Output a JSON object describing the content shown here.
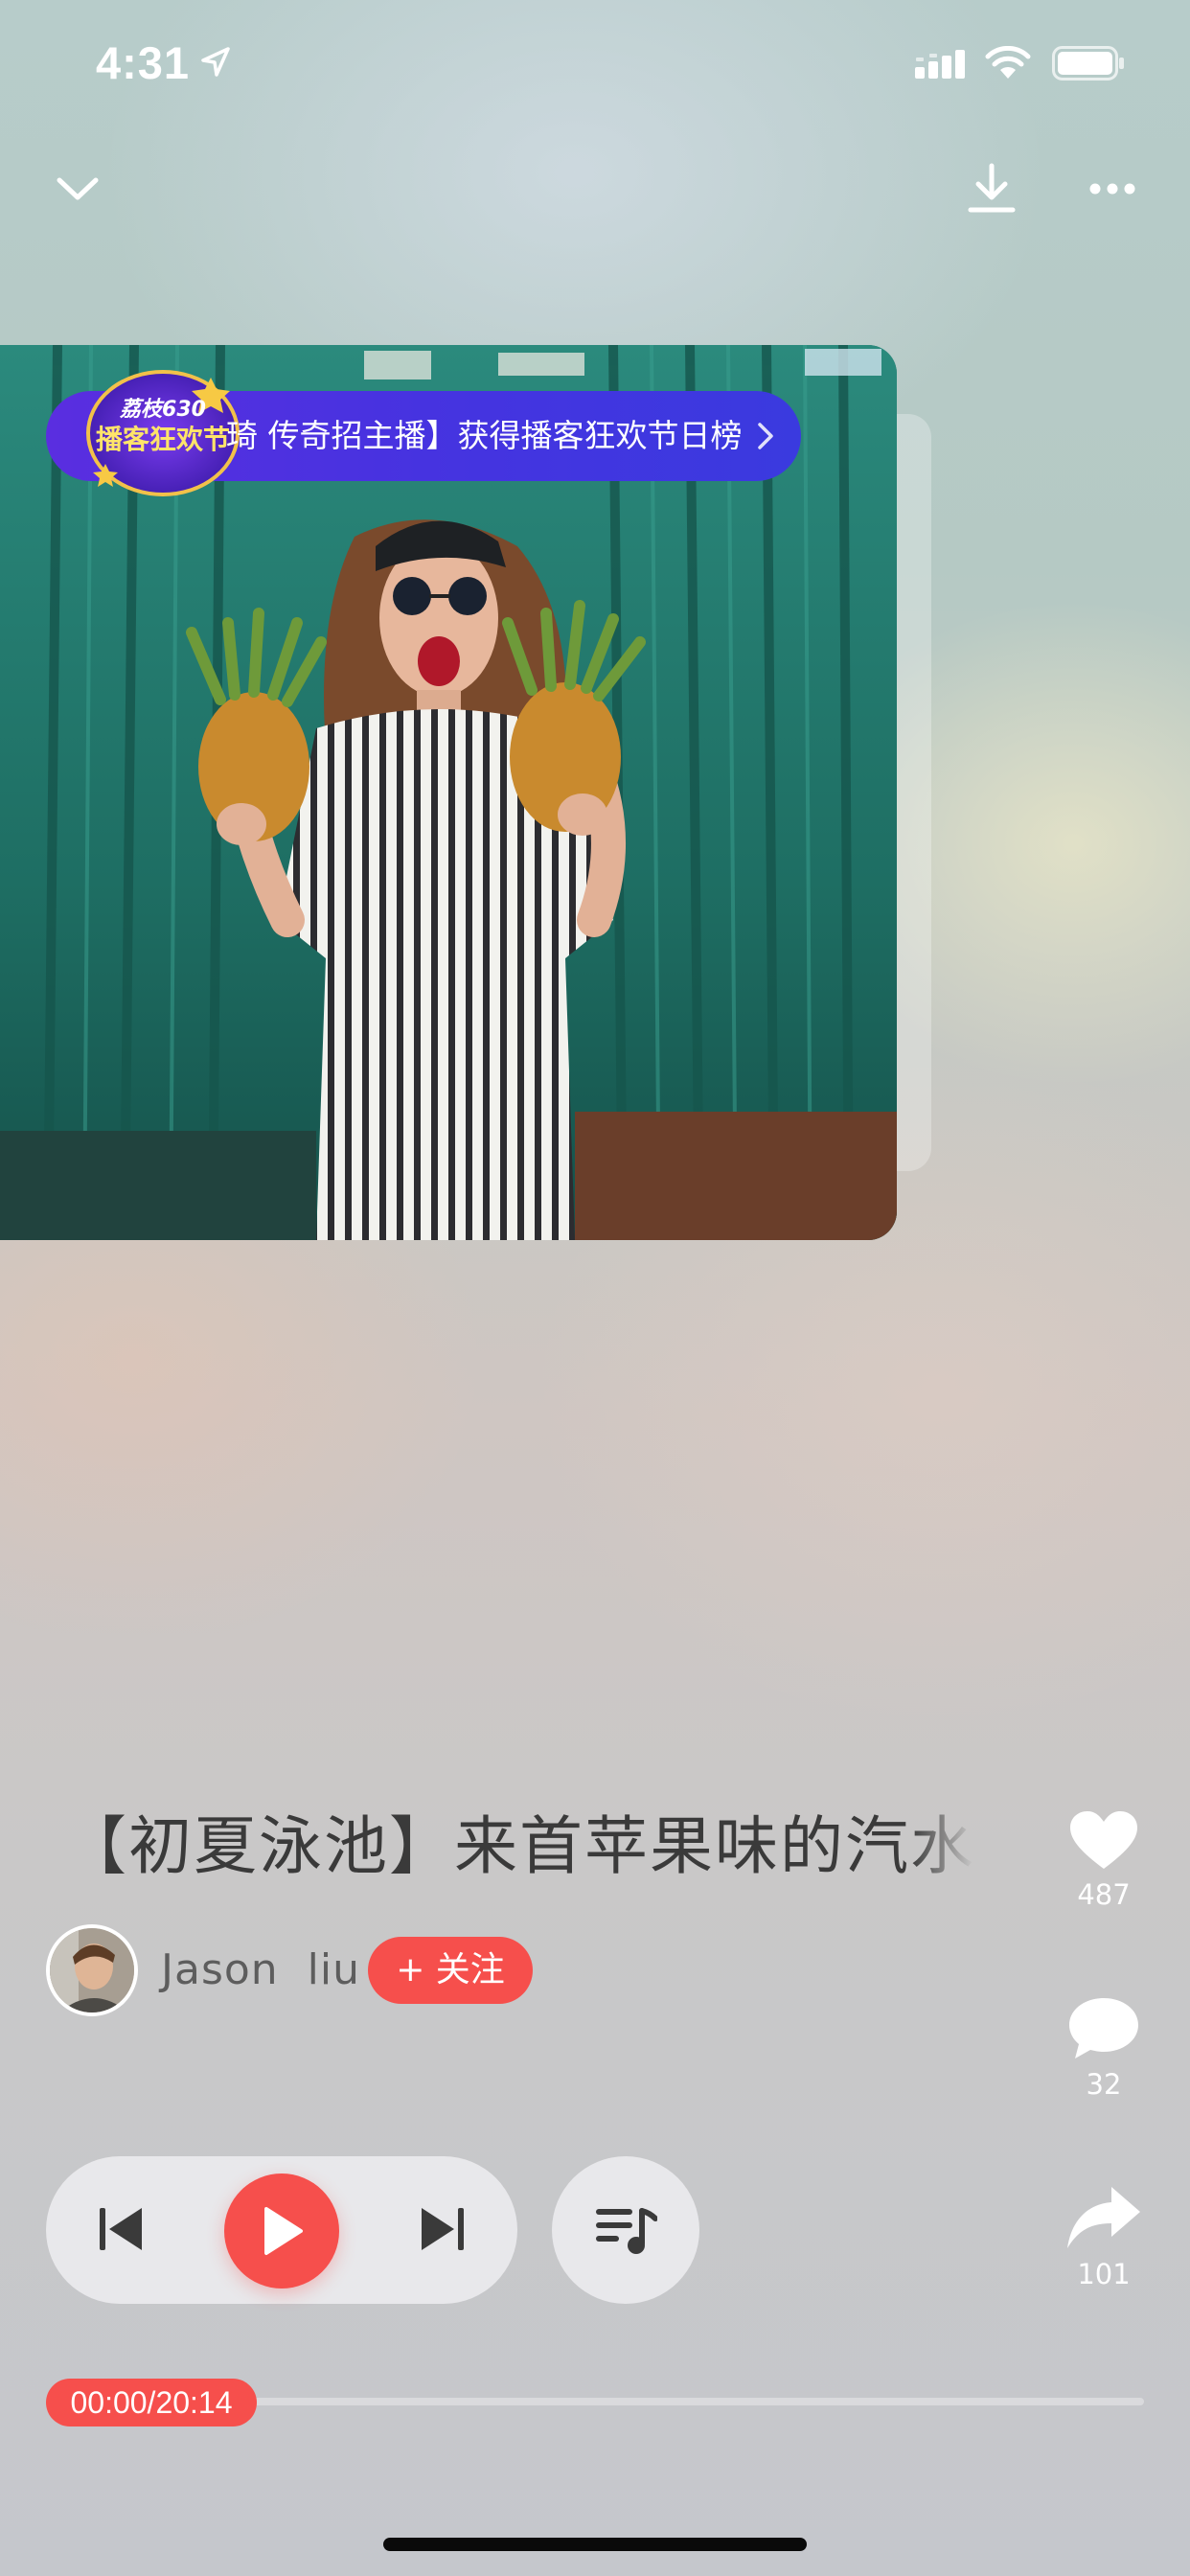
{
  "status_bar": {
    "time": "4:31",
    "icons": [
      "location-arrow-icon",
      "cellular-signal-icon",
      "wifi-icon",
      "battery-icon"
    ]
  },
  "nav": {
    "left_icon": "chevron-down-icon",
    "right_icons": [
      "download-icon",
      "more-icon"
    ]
  },
  "promo": {
    "badge_line1": "荔枝630",
    "badge_line2": "播客狂欢节",
    "text": "琦 传奇招主播】获得播客狂欢节日榜",
    "chevron_icon": "chevron-right-icon"
  },
  "episode": {
    "title": "【初夏泳池】来首苹果味的汽水"
  },
  "author": {
    "name": "Jason  liu",
    "follow_label": "+ 关注"
  },
  "actions": {
    "likes": "487",
    "comments": "32",
    "shares": "101"
  },
  "player": {
    "time_display": "00:00/20:14",
    "progress": 0
  },
  "colors": {
    "accent": "#f64f4c",
    "promo_banner": "#4633e0"
  }
}
